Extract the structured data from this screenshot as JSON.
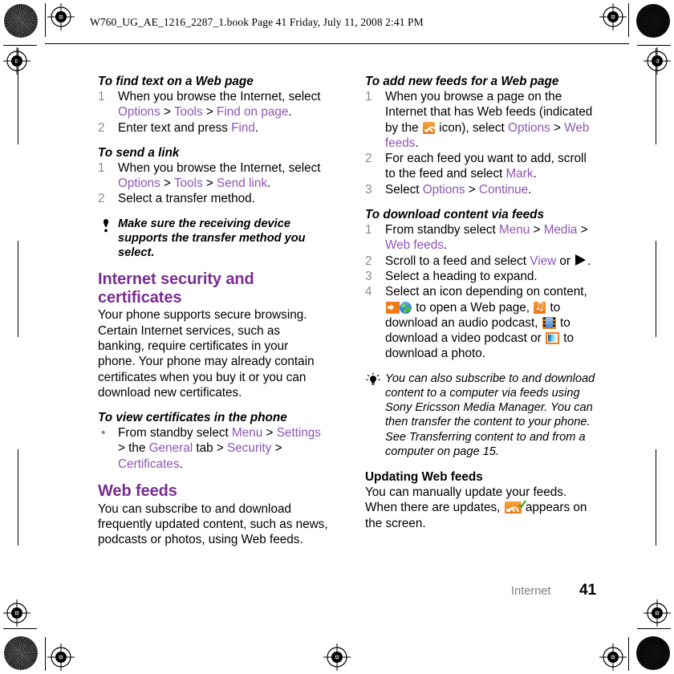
{
  "print_header": {
    "book_line": "W760_UG_AE_1216_2287_1.book  Page 41  Friday, July 11, 2008  2:41 PM"
  },
  "footer": {
    "chapter": "Internet",
    "page_number": "41"
  },
  "icons": {
    "rss": "rss-feed-icon",
    "rss_update": "rss-feed-update-icon",
    "play": "play-triangle-icon",
    "web_page": "open-web-page-icon",
    "audio_podcast": "audio-podcast-icon",
    "video_podcast": "video-podcast-icon",
    "photo": "photo-icon",
    "note": "note-exclamation-icon",
    "tip": "tip-lightbulb-icon"
  },
  "colors": {
    "heading_purple": "#7a2d91",
    "menu_item_purple": "#8e55b5",
    "step_number_gray": "#8a8a8a",
    "accent_orange": "#f07c14",
    "footer_gray": "#7d7d7d"
  },
  "left_column": {
    "proc_find_text": {
      "heading": "To find text on a Web page",
      "steps": [
        {
          "num": "1",
          "parts": [
            {
              "t": "When you browse the Internet, select ",
              "s": "plain"
            },
            {
              "t": "Options",
              "s": "menu"
            },
            {
              "t": " > ",
              "s": "plain"
            },
            {
              "t": "Tools",
              "s": "menu"
            },
            {
              "t": " > ",
              "s": "plain"
            },
            {
              "t": "Find on page",
              "s": "menu"
            },
            {
              "t": ".",
              "s": "plain"
            }
          ]
        },
        {
          "num": "2",
          "parts": [
            {
              "t": "Enter text and press ",
              "s": "plain"
            },
            {
              "t": "Find",
              "s": "menu"
            },
            {
              "t": ".",
              "s": "plain"
            }
          ]
        }
      ]
    },
    "proc_send_link": {
      "heading": "To send a link",
      "steps": [
        {
          "num": "1",
          "parts": [
            {
              "t": "When you browse the Internet, select ",
              "s": "plain"
            },
            {
              "t": "Options",
              "s": "menu"
            },
            {
              "t": " > ",
              "s": "plain"
            },
            {
              "t": "Tools",
              "s": "menu"
            },
            {
              "t": " > ",
              "s": "plain"
            },
            {
              "t": "Send link",
              "s": "menu"
            },
            {
              "t": ".",
              "s": "plain"
            }
          ]
        },
        {
          "num": "2",
          "parts": [
            {
              "t": "Select a transfer method.",
              "s": "plain"
            }
          ]
        }
      ]
    },
    "note": "Make sure the receiving device supports the transfer method you select.",
    "section_security": {
      "heading": "Internet security and certificates",
      "body": "Your phone supports secure browsing. Certain Internet services, such as banking, require certificates in your phone. Your phone may already contain certificates when you buy it or you can download new certificates."
    },
    "proc_view_certificates": {
      "heading": "To view certificates in the phone",
      "steps": [
        {
          "bullet": "•",
          "parts": [
            {
              "t": "From standby select ",
              "s": "plain"
            },
            {
              "t": "Menu",
              "s": "menu"
            },
            {
              "t": " > ",
              "s": "plain"
            },
            {
              "t": "Settings",
              "s": "menu"
            },
            {
              "t": " > the ",
              "s": "plain"
            },
            {
              "t": "General",
              "s": "menu"
            },
            {
              "t": " tab > ",
              "s": "plain"
            },
            {
              "t": "Security",
              "s": "menu"
            },
            {
              "t": " > ",
              "s": "plain"
            },
            {
              "t": "Certificates",
              "s": "menu"
            },
            {
              "t": ".",
              "s": "plain"
            }
          ]
        }
      ]
    },
    "section_web_feeds": {
      "heading": "Web feeds",
      "body": "You can subscribe to and download frequently updated content, such as news, podcasts or photos, using Web feeds."
    }
  },
  "right_column": {
    "proc_add_feeds": {
      "heading": "To add new feeds for a Web page",
      "steps": [
        {
          "num": "1",
          "parts": [
            {
              "t": "When you browse a page on the Internet that has Web feeds (indicated by the ",
              "s": "plain"
            },
            {
              "t": "",
              "s": "icon-rss"
            },
            {
              "t": " icon), select ",
              "s": "plain"
            },
            {
              "t": "Options",
              "s": "menu"
            },
            {
              "t": " > ",
              "s": "plain"
            },
            {
              "t": "Web feeds",
              "s": "menu"
            },
            {
              "t": ".",
              "s": "plain"
            }
          ]
        },
        {
          "num": "2",
          "parts": [
            {
              "t": "For each feed you want to add, scroll to the feed and select ",
              "s": "plain"
            },
            {
              "t": "Mark",
              "s": "menu"
            },
            {
              "t": ".",
              "s": "plain"
            }
          ]
        },
        {
          "num": "3",
          "parts": [
            {
              "t": "Select ",
              "s": "plain"
            },
            {
              "t": "Options",
              "s": "menu"
            },
            {
              "t": " > ",
              "s": "plain"
            },
            {
              "t": "Continue",
              "s": "menu"
            },
            {
              "t": ".",
              "s": "plain"
            }
          ]
        }
      ]
    },
    "proc_download_content": {
      "heading": "To download content via feeds",
      "steps": [
        {
          "num": "1",
          "parts": [
            {
              "t": "From standby select ",
              "s": "plain"
            },
            {
              "t": "Menu",
              "s": "menu"
            },
            {
              "t": " > ",
              "s": "plain"
            },
            {
              "t": "Media",
              "s": "menu"
            },
            {
              "t": " > ",
              "s": "plain"
            },
            {
              "t": "Web feeds",
              "s": "menu"
            },
            {
              "t": ".",
              "s": "plain"
            }
          ]
        },
        {
          "num": "2",
          "parts": [
            {
              "t": "Scroll to a feed and select ",
              "s": "plain"
            },
            {
              "t": "View",
              "s": "menu"
            },
            {
              "t": " or ",
              "s": "plain"
            },
            {
              "t": "",
              "s": "icon-play"
            },
            {
              "t": ".",
              "s": "plain"
            }
          ]
        },
        {
          "num": "3",
          "parts": [
            {
              "t": "Select a heading to expand.",
              "s": "plain"
            }
          ]
        },
        {
          "num": "4",
          "parts": [
            {
              "t": "Select an icon depending on content, ",
              "s": "plain"
            },
            {
              "t": "",
              "s": "icon-webpage"
            },
            {
              "t": " to open a Web page, ",
              "s": "plain"
            },
            {
              "t": "",
              "s": "icon-audio"
            },
            {
              "t": " to download an audio podcast, ",
              "s": "plain"
            },
            {
              "t": "",
              "s": "icon-video"
            },
            {
              "t": " to download a video podcast or ",
              "s": "plain"
            },
            {
              "t": "",
              "s": "icon-photo"
            },
            {
              "t": " to download a photo.",
              "s": "plain"
            }
          ]
        }
      ]
    },
    "tip": "You can also subscribe to and download content to a computer via feeds using Sony Ericsson Media Manager. You can then transfer the content to your phone. See Transferring content to and from a computer on page 15.",
    "section_updating": {
      "heading": "Updating Web feeds",
      "body_parts": [
        {
          "t": "You can manually update your feeds. When there are updates, ",
          "s": "plain"
        },
        {
          "t": "",
          "s": "icon-rss-check"
        },
        {
          "t": " appears on the screen.",
          "s": "plain"
        }
      ]
    }
  }
}
